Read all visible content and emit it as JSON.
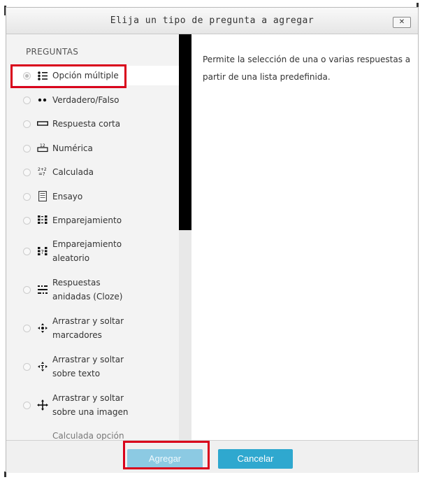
{
  "dialog": {
    "title": "Elija un tipo de pregunta a agregar",
    "close_label": "✕"
  },
  "left_panel": {
    "heading": "PREGUNTAS",
    "options": [
      {
        "label": "Opción múltiple",
        "icon": "multichoice-icon",
        "selected": true
      },
      {
        "label": "Verdadero/Falso",
        "icon": "truefalse-icon",
        "selected": false
      },
      {
        "label": "Respuesta corta",
        "icon": "shortanswer-icon",
        "selected": false
      },
      {
        "label": "Numérica",
        "icon": "numerical-icon",
        "selected": false
      },
      {
        "label": "Calculada",
        "icon": "calculated-icon",
        "selected": false
      },
      {
        "label": "Ensayo",
        "icon": "essay-icon",
        "selected": false
      },
      {
        "label": "Emparejamiento",
        "icon": "matching-icon",
        "selected": false
      },
      {
        "label_line1": "Emparejamiento",
        "label_line2": "aleatorio",
        "icon": "random-matching-icon",
        "selected": false
      },
      {
        "label_line1": "Respuestas",
        "label_line2": "anidadas (Cloze)",
        "icon": "cloze-icon",
        "selected": false
      },
      {
        "label_line1": "Arrastrar y soltar",
        "label_line2": "marcadores",
        "icon": "drag-drop-markers-icon",
        "selected": false
      },
      {
        "label_line1": "Arrastrar y soltar",
        "label_line2": "sobre texto",
        "icon": "drag-drop-text-icon",
        "selected": false
      },
      {
        "label_line1": "Arrastrar y soltar",
        "label_line2": "sobre una imagen",
        "icon": "drag-drop-image-icon",
        "selected": false
      },
      {
        "label": "Calculada opción",
        "icon": "calculated-multi-icon",
        "selected": false
      }
    ]
  },
  "description": "Permite la selección de una o varias respuestas a partir de una lista predefinida.",
  "footer": {
    "add_label": "Agregar",
    "cancel_label": "Cancelar"
  },
  "colors": {
    "highlight": "#d9001b",
    "button_primary": "#2fa8cf",
    "button_disabled": "#8ccae3"
  }
}
